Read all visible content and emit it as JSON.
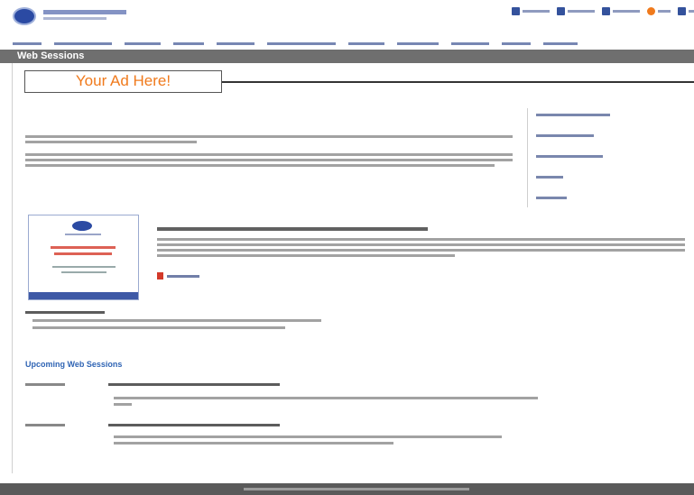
{
  "page": {
    "title_bar": "Web Sessions"
  },
  "ad": {
    "label": "Your Ad Here!"
  },
  "upcoming": {
    "heading": "Upcoming Web Sessions"
  },
  "colors": {
    "brand_blue": "#2b4aa3",
    "accent_orange": "#f07a1c",
    "title_bar_gray": "#6f6f6f",
    "link_blue": "#2f64b4"
  },
  "icons": [
    "logo-icon",
    "pdf-icon",
    "utility-icon"
  ]
}
